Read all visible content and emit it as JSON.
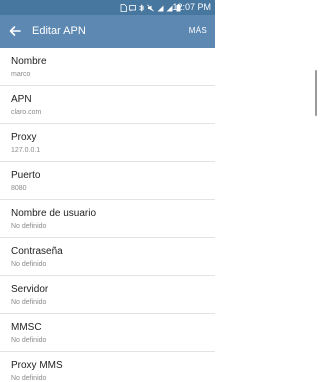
{
  "status_bar": {
    "time": "12:07 PM",
    "icons": [
      "sim-icon",
      "message-icon",
      "bluetooth-icon",
      "mute-icon",
      "signal-icon",
      "signal-icon-2",
      "battery-icon"
    ]
  },
  "app_bar": {
    "title": "Editar APN",
    "more_label": "MÁS"
  },
  "settings": [
    {
      "title": "Nombre",
      "value": "marco"
    },
    {
      "title": "APN",
      "value": "claro.com"
    },
    {
      "title": "Proxy",
      "value": "127.0.0.1"
    },
    {
      "title": "Puerto",
      "value": "8080"
    },
    {
      "title": "Nombre de usuario",
      "value": "No definido"
    },
    {
      "title": "Contraseña",
      "value": "No definido"
    },
    {
      "title": "Servidor",
      "value": "No definido"
    },
    {
      "title": "MMSC",
      "value": "No definido"
    },
    {
      "title": "Proxy MMS",
      "value": "No definido"
    }
  ]
}
